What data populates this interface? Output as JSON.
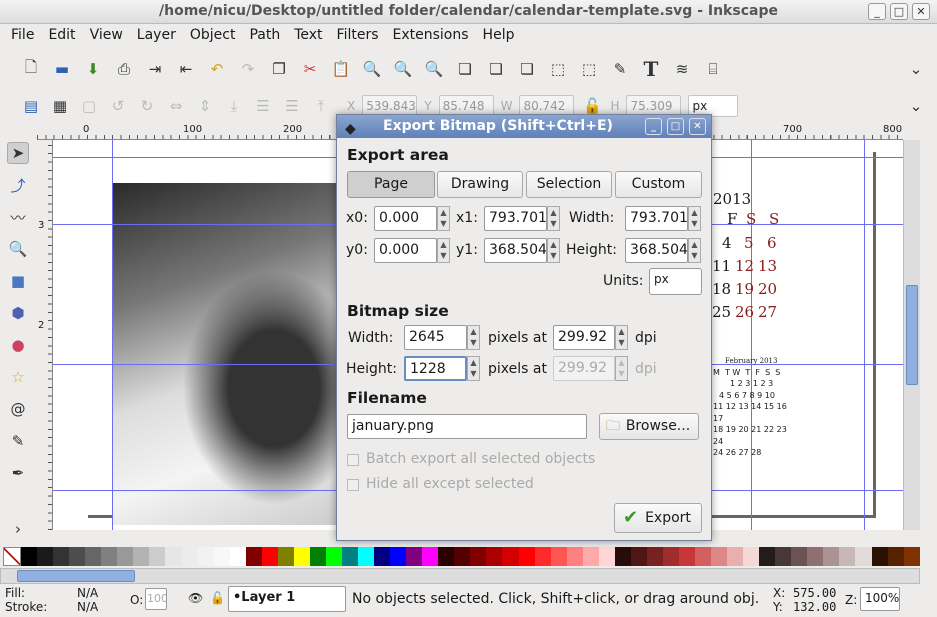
{
  "window": {
    "title": "/home/nicu/Desktop/untitled folder/calendar/calendar-template.svg - Inkscape"
  },
  "menu": [
    "File",
    "Edit",
    "View",
    "Layer",
    "Object",
    "Path",
    "Text",
    "Filters",
    "Extensions",
    "Help"
  ],
  "toolbar2": {
    "x_label": "X",
    "x": "539.843",
    "y_label": "Y",
    "y": "85.748",
    "w_label": "W",
    "w": "80.742",
    "h_label": "H",
    "h": "75.309",
    "units": "px"
  },
  "ruler": {
    "ticks": [
      "0",
      "100",
      "200",
      "700",
      "800"
    ],
    "left": [
      "3",
      "2"
    ]
  },
  "calendar": {
    "year": "2013",
    "days": [
      "F",
      "S",
      "S"
    ],
    "rows": [
      [
        "4",
        "5",
        "6"
      ],
      [
        "11",
        "12",
        "13"
      ],
      [
        "18",
        "19",
        "20"
      ],
      [
        "25",
        "26",
        "27"
      ]
    ],
    "mini": {
      "title": "February 2013",
      "header": "M  T W  T  F  S  S",
      "rows": [
        "1  2  3  1  2  3",
        "4  5  6  7  8  9 10",
        "11 12 13 14 15 16 17",
        "18 19 20 21 22 23 24",
        "24 26 27 28"
      ]
    }
  },
  "dialog": {
    "title": "Export Bitmap (Shift+Ctrl+E)",
    "export_area": "Export area",
    "tabs": [
      "Page",
      "Drawing",
      "Selection",
      "Custom"
    ],
    "active_tab": "Page",
    "x0_label": "x0:",
    "x0": "0.000",
    "x1_label": "x1:",
    "x1": "793.701",
    "width_label": "Width:",
    "width": "793.701",
    "y0_label": "y0:",
    "y0": "0.000",
    "y1_label": "y1:",
    "y1": "368.504",
    "height_label": "Height:",
    "height": "368.504",
    "units_label": "Units:",
    "units": "px",
    "bitmap_size": "Bitmap size",
    "bw_label": "Width:",
    "bw": "2645",
    "pixels_at": "pixels at",
    "dpi_x": "299.92",
    "dpi": "dpi",
    "bh_label": "Height:",
    "bh": "1228",
    "dpi_y": "299.92",
    "filename_label": "Filename",
    "filename": "january.png",
    "browse": "Browse...",
    "batch": "Batch export all selected objects",
    "hide": "Hide all except selected",
    "export": "Export"
  },
  "palette": [
    "#000000",
    "#1a1a1a",
    "#333333",
    "#4d4d4d",
    "#666666",
    "#808080",
    "#999999",
    "#b3b3b3",
    "#cccccc",
    "#e6e6e6",
    "#ececec",
    "#f2f2f2",
    "#f8f8f8",
    "#ffffff",
    "#800000",
    "#ff0000",
    "#808000",
    "#ffff00",
    "#008000",
    "#00ff00",
    "#008080",
    "#00ffff",
    "#000080",
    "#0000ff",
    "#800080",
    "#ff00ff",
    "#2b0000",
    "#550000",
    "#800000",
    "#aa0000",
    "#d40000",
    "#ff0000",
    "#ff2a2a",
    "#ff5555",
    "#ff8080",
    "#ffaaaa",
    "#ffd5d5",
    "#280b0b",
    "#501616",
    "#782121",
    "#a02c2c",
    "#c83737",
    "#d35f5f",
    "#de8787",
    "#e9afaf",
    "#f4d7d7",
    "#241c1c",
    "#483737",
    "#6c5353",
    "#916f6f",
    "#ac9393",
    "#c8b7b7",
    "#e3dbdb",
    "#2b1100",
    "#552200",
    "#803300"
  ],
  "status": {
    "fill_label": "Fill:",
    "fill": "N/A",
    "stroke_label": "Stroke:",
    "stroke": "N/A",
    "opacity_label": "O:",
    "opacity": "100",
    "layer": "•Layer 1",
    "message": "No objects selected. Click, Shift+click, or drag around obj.",
    "x_label": "X:",
    "x": "575.00",
    "y_label": "Y:",
    "y": "132.00",
    "zoom_label": "Z:",
    "zoom": "100%"
  }
}
